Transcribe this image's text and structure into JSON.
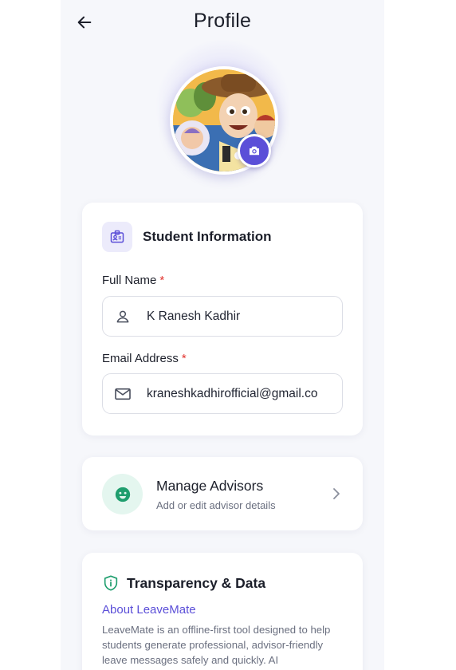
{
  "header": {
    "title": "Profile"
  },
  "colors": {
    "accent": "#5b4fd8",
    "required": "#e2342f",
    "success_bg": "#e4f6ef",
    "success": "#1f9e6e"
  },
  "student_info": {
    "title": "Student Information",
    "full_name": {
      "label": "Full Name",
      "required_mark": "*",
      "value": "K Ranesh Kadhir"
    },
    "email": {
      "label": "Email Address",
      "required_mark": "*",
      "value": "kraneshkadhirofficial@gmail.co"
    }
  },
  "advisors": {
    "title": "Manage Advisors",
    "subtitle": "Add or edit advisor details"
  },
  "transparency": {
    "title": "Transparency & Data",
    "about_link": "About LeaveMate",
    "about_text": "LeaveMate is an offline-first tool designed to help students generate professional, advisor-friendly leave messages safely and quickly. AI"
  },
  "icons": {
    "back": "arrow-left-icon",
    "camera": "camera-icon",
    "student": "id-badge-icon",
    "user": "user-icon",
    "mail": "mail-icon",
    "advisors": "smile-icon",
    "chevron": "chevron-right-icon",
    "shield": "shield-info-icon"
  }
}
